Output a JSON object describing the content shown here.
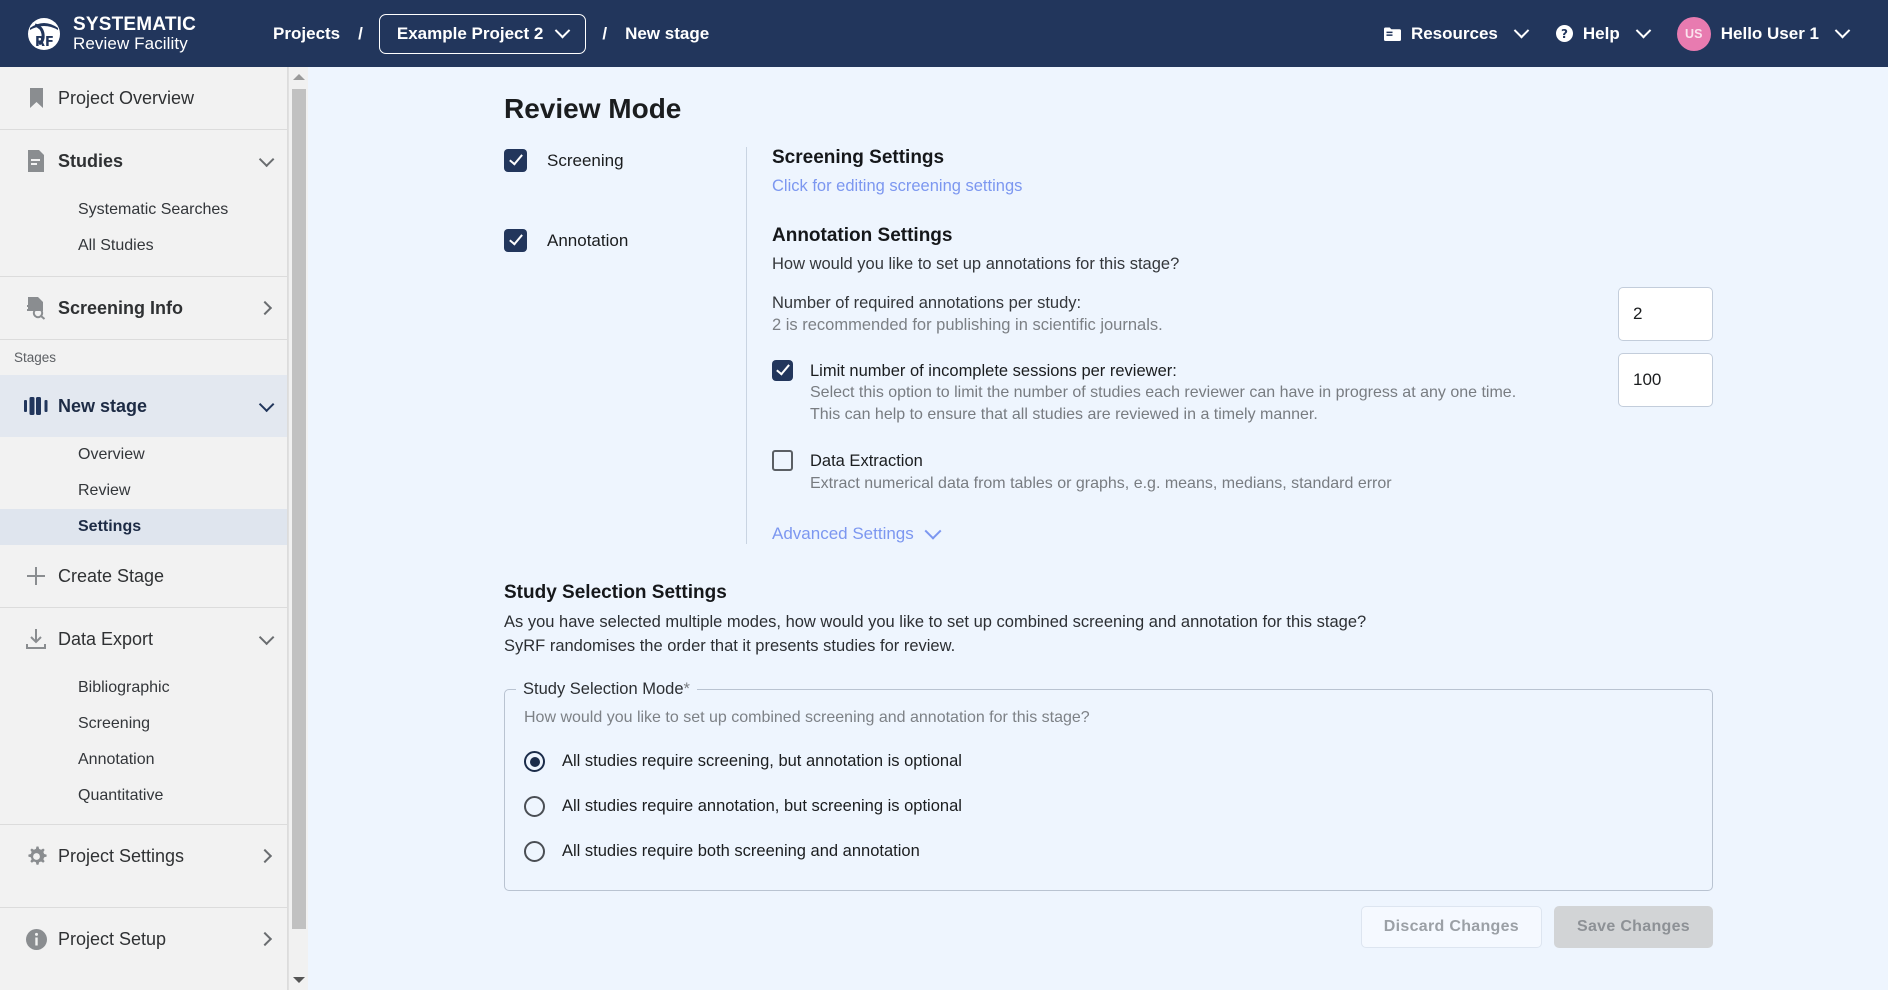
{
  "brand": {
    "line1": "SYSTEMATIC",
    "line2": "Review Facility",
    "logo_icon": "syrf-logo-icon"
  },
  "breadcrumb": {
    "projects": "Projects",
    "sep1": "/",
    "project": "Example Project 2",
    "sep2": "/",
    "stage": "New stage"
  },
  "nav_right": {
    "resources": "Resources",
    "help": "Help",
    "user": "Hello User 1",
    "avatar_initials": "US"
  },
  "sidebar": {
    "project_overview": "Project Overview",
    "studies": "Studies",
    "systematic_searches": "Systematic Searches",
    "all_studies": "All Studies",
    "screening_info": "Screening Info",
    "stages_label": "Stages",
    "new_stage": "New stage",
    "overview": "Overview",
    "review": "Review",
    "settings": "Settings",
    "create_stage": "Create Stage",
    "data_export": "Data Export",
    "bibliographic": "Bibliographic",
    "export_screening": "Screening",
    "export_annotation": "Annotation",
    "quantitative": "Quantitative",
    "project_settings": "Project Settings",
    "project_setup": "Project Setup"
  },
  "main": {
    "page_title": "Review Mode",
    "screening_checkbox_label": "Screening",
    "annotation_checkbox_label": "Annotation",
    "screening_settings_heading": "Screening Settings",
    "screening_settings_link": "Click for editing screening settings",
    "annotation_settings_heading": "Annotation Settings",
    "annotation_settings_question": "How would you like to set up annotations for this stage?",
    "required_annotations_label": "Number of required annotations per study:",
    "required_annotations_hint": "2 is recommended for publishing in scientific journals.",
    "required_annotations_value": "2",
    "limit_sessions_label": "Limit number of incomplete sessions per reviewer:",
    "limit_sessions_desc_1": "Select this option to limit the number of studies each reviewer can have in progress at any one time.",
    "limit_sessions_desc_2": "This can help to ensure that all studies are reviewed in a timely manner.",
    "limit_sessions_value": "100",
    "data_extraction_label": "Data Extraction",
    "data_extraction_desc": "Extract numerical data from tables or graphs, e.g. means, medians, standard error",
    "advanced_settings": "Advanced Settings"
  },
  "study_selection": {
    "heading": "Study Selection Settings",
    "para_1": "As you have selected multiple modes, how would you like to set up combined screening and annotation for this stage?",
    "para_2": "SyRF randomises the order that it presents studies for review.",
    "legend": "Study Selection Mode",
    "legend_star": "*",
    "hint": "How would you like to set up combined screening and annotation for this stage?",
    "options": [
      {
        "label": "All studies require screening, but annotation is optional",
        "selected": true
      },
      {
        "label": "All studies require annotation, but screening is optional",
        "selected": false
      },
      {
        "label": "All studies require both screening and annotation",
        "selected": false
      }
    ]
  },
  "footer": {
    "discard": "Discard Changes",
    "save": "Save Changes"
  },
  "colors": {
    "navy": "#22365c",
    "page_bg": "#eef5fe",
    "sidebar_bg": "#f2f2f2",
    "link_blue": "#7c97f0",
    "avatar_pink": "#e87bb0"
  }
}
